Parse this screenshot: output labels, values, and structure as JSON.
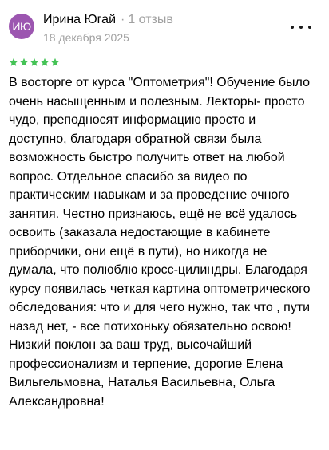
{
  "author": {
    "avatar_initials": "ИЮ",
    "name": "Ирина Югай",
    "separator": "·",
    "reviews_count": "1 отзыв"
  },
  "review": {
    "date": "18 декабря 2025",
    "rating": 5,
    "rating_max": 5,
    "text": "В восторге от курса \"Оптометрия\"! Обучение было очень насыщенным и полезным. Лекторы- просто чудо, преподносят информацию просто и доступно, благодаря обратной связи была возможность быстро получить ответ на любой вопрос. Отдельное спасибо за видео по практическим навыкам и за проведение очного занятия. Честно признаюсь, ещё не всё удалось освоить (заказала недостающие в кабинете приборчики, они ещё в пути), но никогда не думала, что полюблю кросс-цилиндры. Благодаря курсу появилась четкая картина оптометрического обследования: что и для чего нужно, так что , пути назад нет, - все потихоньку обязательно освою! Низкий поклон за ваш труд, высочайший профессионализм и терпение, дорогие Елена Вильгельмовна, Наталья Васильевна, Ольга Александровна!"
  },
  "icons": {
    "more": "more-horizontal-icon",
    "star": "star-icon"
  },
  "colors": {
    "avatar_bg": "#9c56b0",
    "star": "#45c356",
    "secondary_text": "#a0a0a0"
  }
}
